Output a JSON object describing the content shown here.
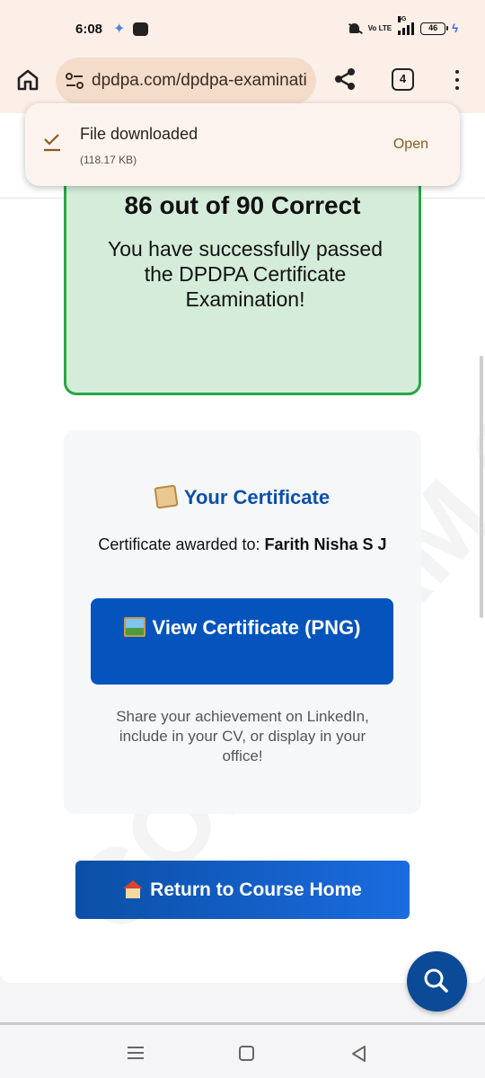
{
  "status_bar": {
    "time": "6:08",
    "network": "5G",
    "battery": "46",
    "volte": "Vo LTE"
  },
  "browser": {
    "url": "dpdpa.com/dpdpa-examinati",
    "tab_count": "4"
  },
  "download": {
    "title": "File downloaded",
    "size": "(118.17 KB)",
    "open_label": "Open"
  },
  "result": {
    "score": "86 out of 90 Correct",
    "message": "You have successfully passed the DPDPA Certificate Examination!"
  },
  "certificate": {
    "heading": "Your Certificate",
    "awarded_prefix": "Certificate awarded to:",
    "recipient": "Farith Nisha S J",
    "view_button": "View Certificate (PNG)",
    "share_message": "Share your achievement on LinkedIn, include in your CV, or display in your office!"
  },
  "return_button": "Return to Course Home",
  "watermark": "COMEXAM © 202",
  "colors": {
    "brand_blue": "#0554bd",
    "success_green": "#28a745",
    "success_bg": "#d4ecd9",
    "browser_bar": "#fcefe8"
  }
}
